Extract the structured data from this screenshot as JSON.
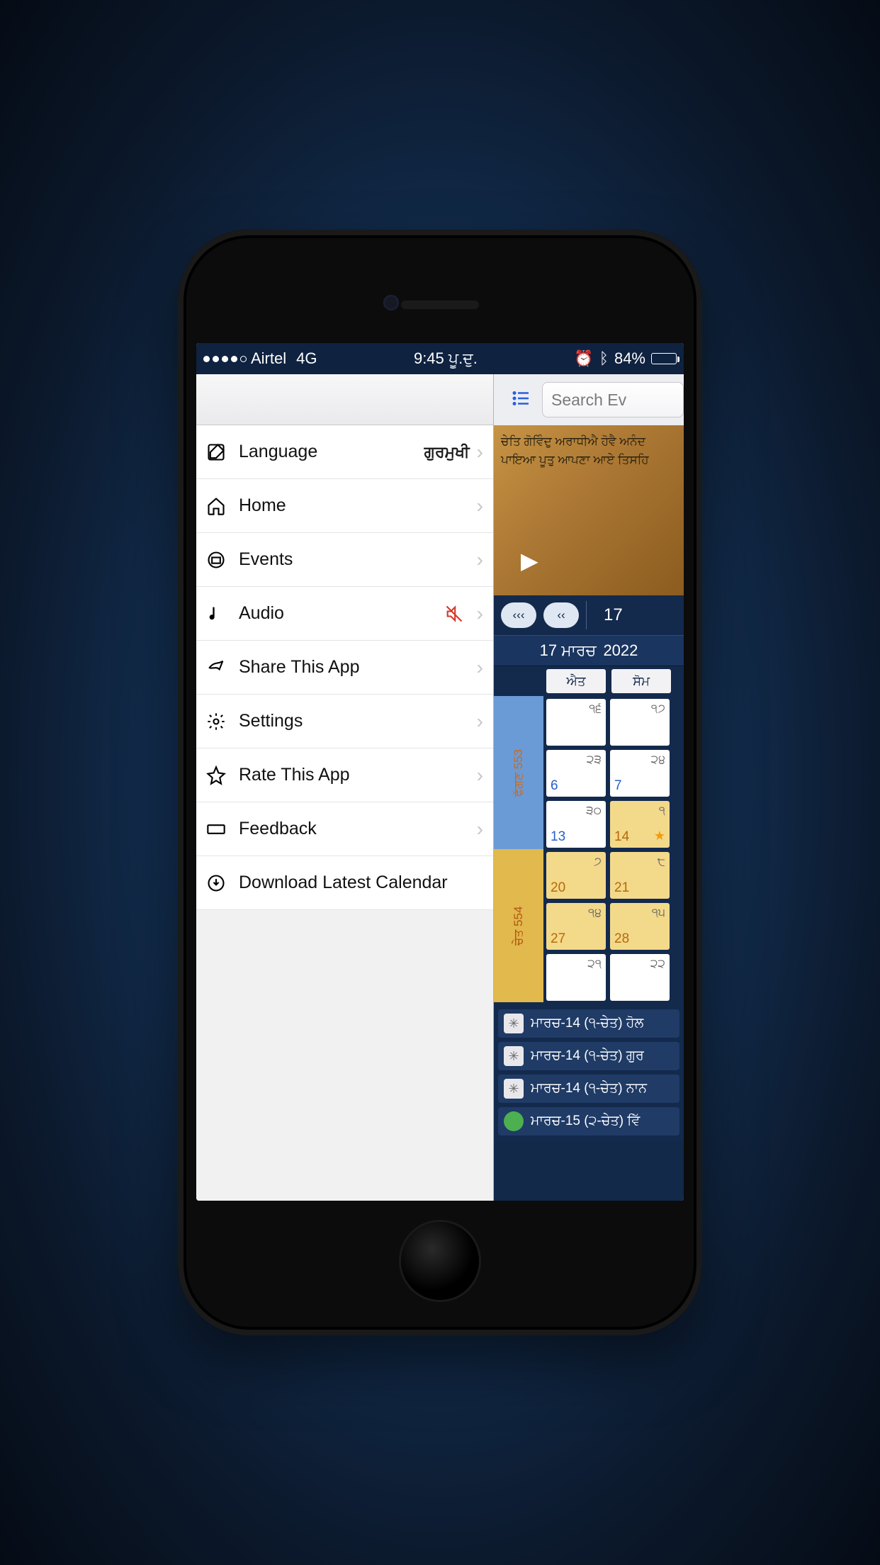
{
  "status": {
    "carrier": "Airtel",
    "network": "4G",
    "time": "9:45 ਪੂ.ਦੁ.",
    "battery_pct": "84%"
  },
  "drawer": {
    "items": [
      {
        "label": "Language",
        "value": "ਗੁਰਮੁਖੀ"
      },
      {
        "label": "Home"
      },
      {
        "label": "Events"
      },
      {
        "label": "Audio"
      },
      {
        "label": "Share This App"
      },
      {
        "label": "Settings"
      },
      {
        "label": "Rate This App"
      },
      {
        "label": "Feedback"
      },
      {
        "label": "Download Latest Calendar"
      }
    ]
  },
  "search": {
    "placeholder": "Search Ev"
  },
  "banner": {
    "line1": "ਚੇਤਿ ਗੋਵਿੰਦੁ ਅਰਾਧੀਐ ਹੋਵੈ ਅਨੰਦ",
    "line2": "ਪਾਇਆ ਪੂਤੁ ਆਪਣਾ ਆਏ ਤਿਸਹਿ"
  },
  "nav": {
    "day": "17"
  },
  "date_row": {
    "date": "17 ਮਾਰਚ",
    "year": "2022"
  },
  "dow": [
    "ਐਤ",
    "ਸੋਮ"
  ],
  "month_labels": {
    "m1": "ਫੱਗਣ 553",
    "m2": "ਚੇਤ 554"
  },
  "grid": [
    [
      {
        "t": "੧੬",
        "b": "",
        "dim": true
      },
      {
        "t": "੧੭",
        "b": "",
        "dim": true
      }
    ],
    [
      {
        "t": "੨੩",
        "b": "6"
      },
      {
        "t": "੨੪",
        "b": "7"
      }
    ],
    [
      {
        "t": "੩੦",
        "b": "13"
      },
      {
        "t": "੧",
        "b": "14",
        "hi": true,
        "star": true
      }
    ],
    [
      {
        "t": "੭",
        "b": "20",
        "hi": true
      },
      {
        "t": "੮",
        "b": "21",
        "hi": true
      }
    ],
    [
      {
        "t": "੧੪",
        "b": "27",
        "hi": true
      },
      {
        "t": "੧੫",
        "b": "28",
        "hi": true
      }
    ],
    [
      {
        "t": "੨੧",
        "b": "",
        "dim": true
      },
      {
        "t": "੨੨",
        "b": "",
        "dim": true
      }
    ]
  ],
  "events": [
    {
      "text": "ਮਾਰਚ-14 (੧-ਚੇਤ) ਹੋਲ"
    },
    {
      "text": "ਮਾਰਚ-14 (੧-ਚੇਤ) ਗੁਰ"
    },
    {
      "text": "ਮਾਰਚ-14 (੧-ਚੇਤ) ਨਾਨ"
    },
    {
      "text": "ਮਾਰਚ-15 (੨-ਚੇਤ) ਵਿੱ",
      "green": true
    }
  ]
}
